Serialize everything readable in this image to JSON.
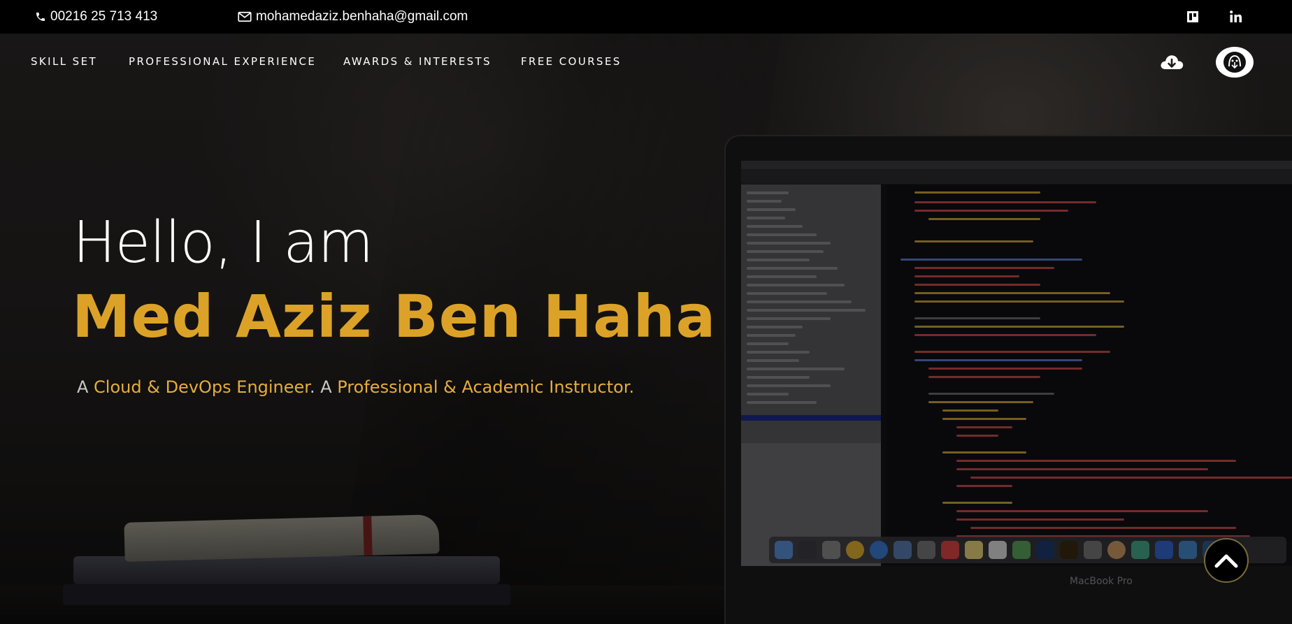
{
  "topbar": {
    "phone": "00216 25 713 413",
    "email": "mohamedaziz.benhaha@gmail.com",
    "social_icons": [
      "blog-icon",
      "linkedin-icon"
    ]
  },
  "nav": {
    "items": [
      {
        "label": "SKILL SET"
      },
      {
        "label": "PROFESSIONAL EXPERIENCE"
      },
      {
        "label": "AWARDS & INTERESTS"
      },
      {
        "label": "FREE COURSES"
      }
    ],
    "download_icon": "cloud-download-icon",
    "avatar_icon": "profile-avatar-icon"
  },
  "hero": {
    "greeting": "Hello, I am",
    "name": "Med Aziz Ben Haha",
    "tagline": {
      "prefix1": "A ",
      "role1": "Cloud & DevOps Engineer",
      "sep": ". A ",
      "role2": "Professional & Academic Instructor",
      "suffix": "."
    }
  },
  "background": {
    "laptop_label": "MacBook Pro"
  },
  "scroll_top_icon": "chevron-up-icon",
  "colors": {
    "accent": "#dca228",
    "topbar": "#000000",
    "text": "#ffffff"
  }
}
